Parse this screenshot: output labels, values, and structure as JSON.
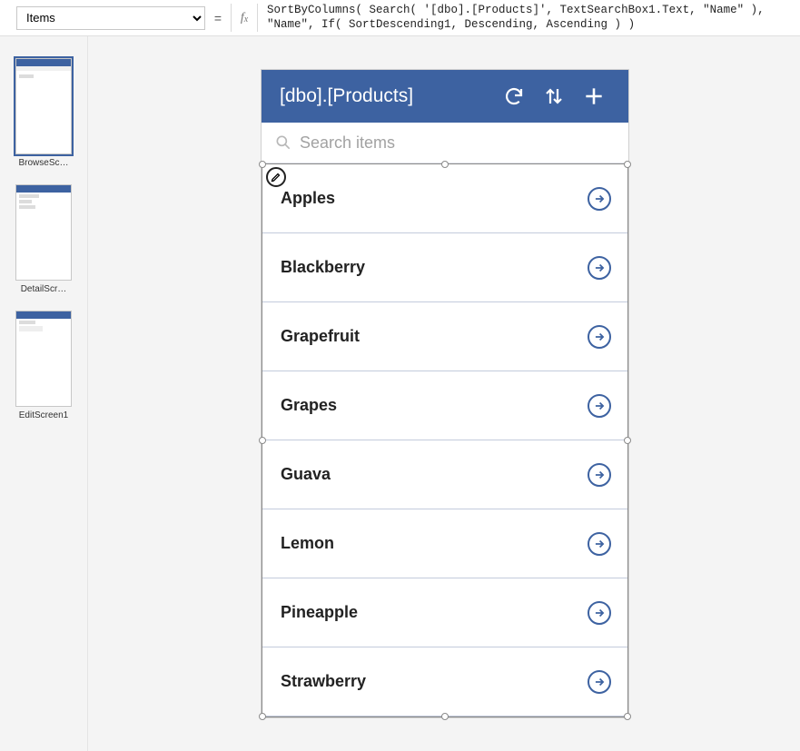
{
  "propertyDropdown": {
    "value": "Items"
  },
  "formula": "SortByColumns( Search( '[dbo].[Products]', TextSearchBox1.Text, \"Name\" ),\n\"Name\", If( SortDescending1, Descending, Ascending ) )",
  "thumbs": [
    {
      "label": "BrowseSc…"
    },
    {
      "label": "DetailScr…"
    },
    {
      "label": "EditScreen1"
    }
  ],
  "app": {
    "title": "[dbo].[Products]",
    "searchPlaceholder": "Search items",
    "items": [
      {
        "name": "Apples"
      },
      {
        "name": "Blackberry"
      },
      {
        "name": "Grapefruit"
      },
      {
        "name": "Grapes"
      },
      {
        "name": "Guava"
      },
      {
        "name": "Lemon"
      },
      {
        "name": "Pineapple"
      },
      {
        "name": "Strawberry"
      }
    ]
  }
}
